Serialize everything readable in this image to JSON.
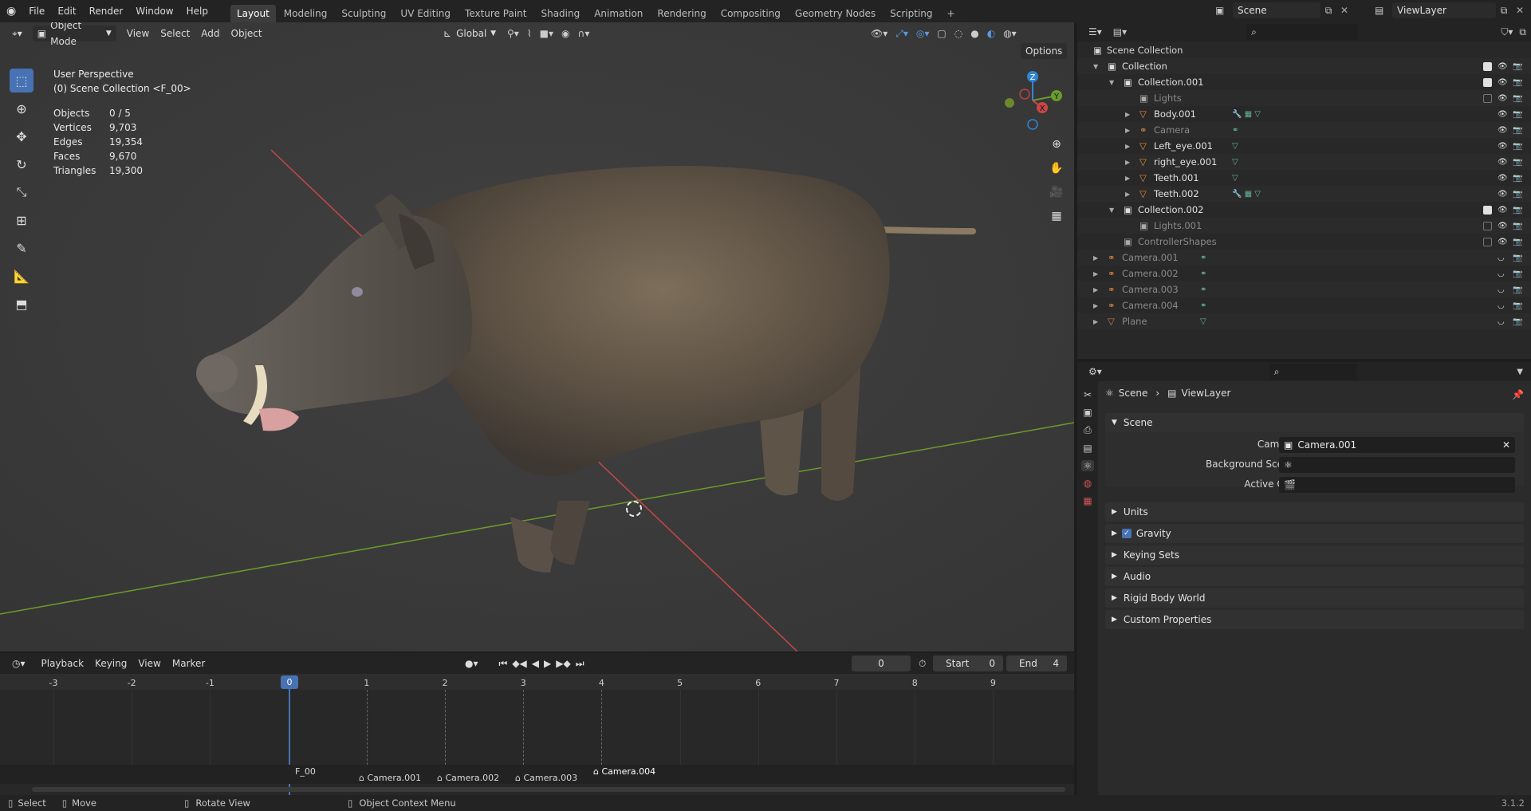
{
  "topbar": {
    "menus": [
      "File",
      "Edit",
      "Render",
      "Window",
      "Help"
    ],
    "workspaces": [
      "Layout",
      "Modeling",
      "Sculpting",
      "UV Editing",
      "Texture Paint",
      "Shading",
      "Animation",
      "Rendering",
      "Compositing",
      "Geometry Nodes",
      "Scripting"
    ],
    "active_workspace": "Layout",
    "add_tab": "+",
    "scene": "Scene",
    "view_layer": "ViewLayer"
  },
  "viewport": {
    "mode": "Object Mode",
    "menus": [
      "View",
      "Select",
      "Add",
      "Object"
    ],
    "orientation": "Global",
    "options": "Options",
    "perspective": "User Perspective",
    "collection_info": "(0) Scene Collection <F_00>",
    "stats": [
      {
        "label": "Objects",
        "value": "0 / 5"
      },
      {
        "label": "Vertices",
        "value": "9,703"
      },
      {
        "label": "Edges",
        "value": "19,354"
      },
      {
        "label": "Faces",
        "value": "9,670"
      },
      {
        "label": "Triangles",
        "value": "19,300"
      }
    ],
    "gizmo": {
      "z": "Z",
      "y": "Y",
      "x": "X"
    },
    "colors": {
      "x_axis": "#c84747",
      "y_axis": "#6c9b2a",
      "z_axis": "#2e86d6",
      "bg": "#3c3c3c"
    }
  },
  "timeline": {
    "menus": [
      "Playback",
      "Keying",
      "View",
      "Marker"
    ],
    "current_frame": "0",
    "start_label": "Start",
    "start": "0",
    "end_label": "End",
    "end": "4",
    "numbers": [
      "-3",
      "-2",
      "-1",
      "0",
      "1",
      "2",
      "3",
      "4",
      "5",
      "6",
      "7",
      "8",
      "9"
    ],
    "markers": [
      "F_00",
      "Camera.001",
      "Camera.002",
      "Camera.003",
      "Camera.004"
    ]
  },
  "outliner": {
    "root": "Scene Collection",
    "rows": [
      {
        "name": "Collection",
        "dim": false
      },
      {
        "name": "Collection.001",
        "dim": false
      },
      {
        "name": "Lights",
        "dim": true
      },
      {
        "name": "Body.001",
        "dim": false
      },
      {
        "name": "Camera",
        "dim": true
      },
      {
        "name": "Left_eye.001",
        "dim": false
      },
      {
        "name": "right_eye.001",
        "dim": false
      },
      {
        "name": "Teeth.001",
        "dim": false
      },
      {
        "name": "Teeth.002",
        "dim": false
      },
      {
        "name": "Collection.002",
        "dim": false
      },
      {
        "name": "Lights.001",
        "dim": true
      },
      {
        "name": "ControllerShapes",
        "dim": true
      },
      {
        "name": "Camera.001",
        "dim": true
      },
      {
        "name": "Camera.002",
        "dim": true
      },
      {
        "name": "Camera.003",
        "dim": true
      },
      {
        "name": "Camera.004",
        "dim": true
      },
      {
        "name": "Plane",
        "dim": true
      }
    ]
  },
  "properties": {
    "breadcrumb_scene": "Scene",
    "breadcrumb_sep": "›",
    "breadcrumb_layer": "ViewLayer",
    "panel_scene": "Scene",
    "camera_label": "Camera",
    "camera_value": "Camera.001",
    "bg_scene_label": "Background Scene",
    "active_clip_label": "Active Clip",
    "panels": [
      "Units",
      "Gravity",
      "Keying Sets",
      "Audio",
      "Rigid Body World",
      "Custom Properties"
    ]
  },
  "status": {
    "select": "Select",
    "move": "Move",
    "rotate": "Rotate View",
    "context": "Object Context Menu",
    "version": "3.1.2"
  }
}
